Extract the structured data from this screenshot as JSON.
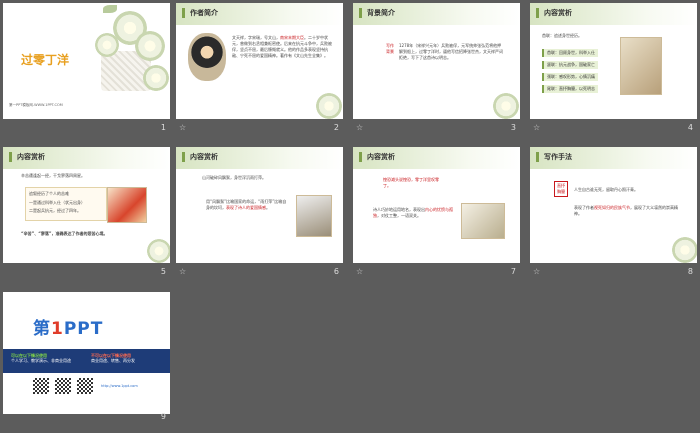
{
  "slides": [
    {
      "num": "1",
      "title": "过零丁洋",
      "subtitle": "第一PPT模板网-WWW.1PPT.COM"
    },
    {
      "num": "2",
      "header": "作者简介",
      "body_a": "文天祥，字宋瑞，号文山，",
      "body_red": "南宋末期大臣",
      "body_b": "。二十岁中状元，曾做到右丞相兼枢密使。后来在抗元斗争中，兵败被俘，坚贞不屈，最后慷慨就义。他的作品多表现坚持抗敌、宁死不屈的爱国精神。著作有《文山先生全集》。"
    },
    {
      "num": "3",
      "header": "背景简介",
      "vlabel": "写作背景",
      "body_a": "1278年（宋祥兴元年）兵败被俘，元军统帅张弘范将他押解到船上，过零丁洋时，逼他写信招降张世杰，文天祥严词拒绝，写下了这首诗以明志。"
    },
    {
      "num": "4",
      "header": "内容赏析",
      "lead": "首联：追述身世经历。",
      "tags": [
        "首联：回顾身世，科举入仕",
        "颔联：抗元战争，国破家亡",
        "颈联：感叹形势，心情沉痛",
        "尾联：直抒胸臆，以死明志"
      ]
    },
    {
      "num": "5",
      "header": "内容赏析",
      "lead": "辛苦遭逢起一经，干戈寥落四周星。",
      "box_a": "追叙经历了个人的苦难",
      "box_b": "一是通过科举入仕（状元出身）",
      "box_c": "二是起兵抗元，经过了四年。",
      "quote": "“辛苦”、“寥落”，准确表达了作者的悲苦心境。"
    },
    {
      "num": "6",
      "header": "内容赏析",
      "lead": "山河破碎风飘絮，身世浮沉雨打萍。",
      "body_a": "用“风飘絮”比喻国家的命运，“雨打萍”比喻自身的坎坷，",
      "body_red": "表现了诗人的爱国情感",
      "body_b": "。"
    },
    {
      "num": "7",
      "header": "内容赏析",
      "lead_red": "惶恐滩头说惶恐，零丁洋里叹零丁。",
      "body_a": "诗人巧妙地运用地名，表现出",
      "body_red": "内心的忧愤与孤独",
      "body_b": "，对仗工整，一语双关。"
    },
    {
      "num": "8",
      "header": "写作手法",
      "vlabel": "直抒胸臆",
      "lead": "人生自古谁无死，留取丹心照汗青。",
      "body_a": "表现了作者",
      "body_red": "视死如归的民族气节",
      "body_b": "，展现了大义凛然的崇高精神。"
    },
    {
      "num": "9",
      "logo_a": "第",
      "logo_b": "1",
      "logo_c": "PPT",
      "col1_title": "可以在以下情况使用",
      "col1_text": "个人学习、教学演示、非商业用途",
      "col2_title": "不可以在以下情况使用",
      "col2_text": "商业用途、转售、再分发",
      "link": "http://www.1ppt.com"
    }
  ]
}
